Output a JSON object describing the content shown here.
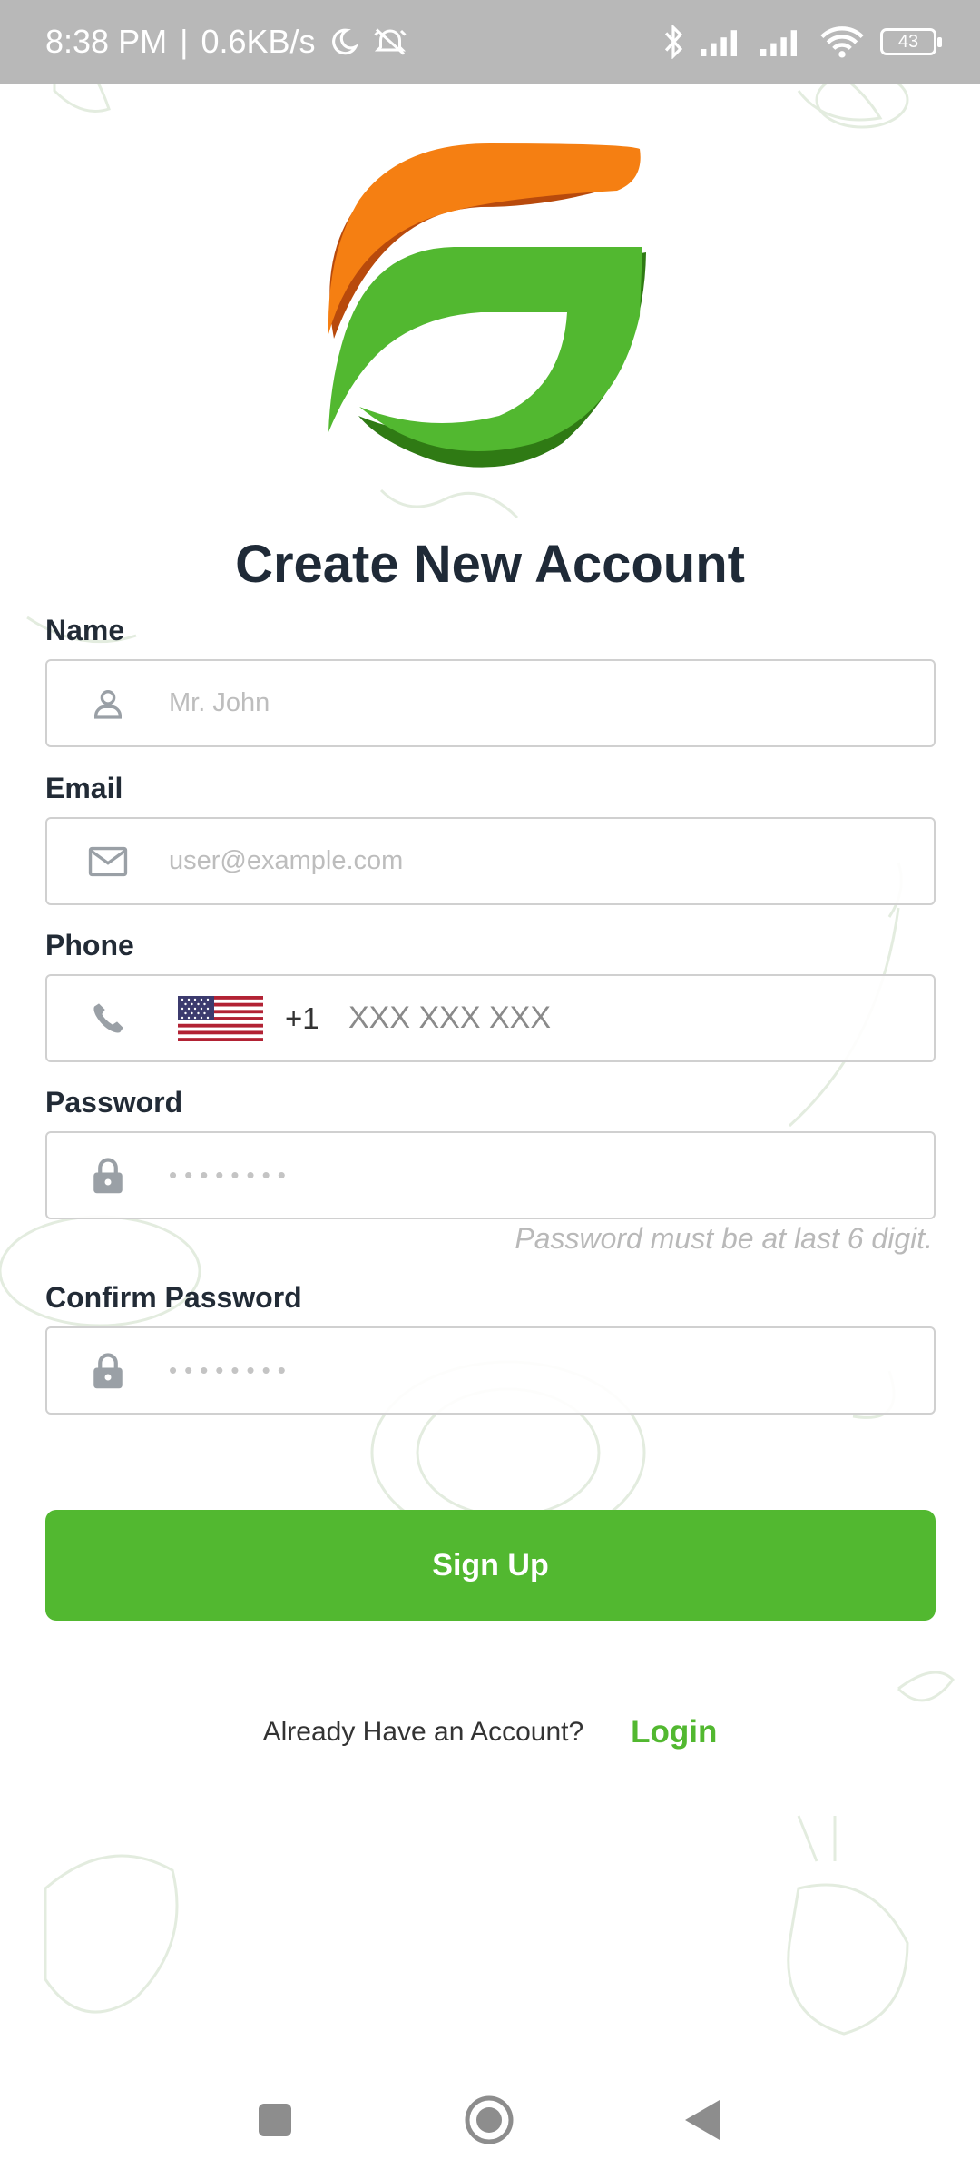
{
  "status_bar": {
    "time": "8:38 PM",
    "separator": "|",
    "speed": "0.6KB/s",
    "battery": "43"
  },
  "page": {
    "title": "Create New Account"
  },
  "form": {
    "name": {
      "label": "Name",
      "placeholder": "Mr. John",
      "icon": "person-icon"
    },
    "email": {
      "label": "Email",
      "placeholder": "user@example.com",
      "icon": "mail-icon"
    },
    "phone": {
      "label": "Phone",
      "dial_code": "+1",
      "placeholder": "XXX XXX XXX",
      "icon": "phone-icon",
      "flag": "us-flag-icon"
    },
    "password": {
      "label": "Password",
      "placeholder": "••••••••",
      "icon": "lock-icon",
      "hint": "Password must be at last 6 digit."
    },
    "confirm_password": {
      "label": "Confirm Password",
      "placeholder": "••••••••",
      "icon": "lock-icon"
    }
  },
  "actions": {
    "signup_label": "Sign Up",
    "login_question": "Already Have an Account?",
    "login_label": "Login"
  },
  "colors": {
    "brand_green": "#52b830",
    "brand_orange": "#f57f12",
    "status_bar": "#b8b8b8"
  }
}
